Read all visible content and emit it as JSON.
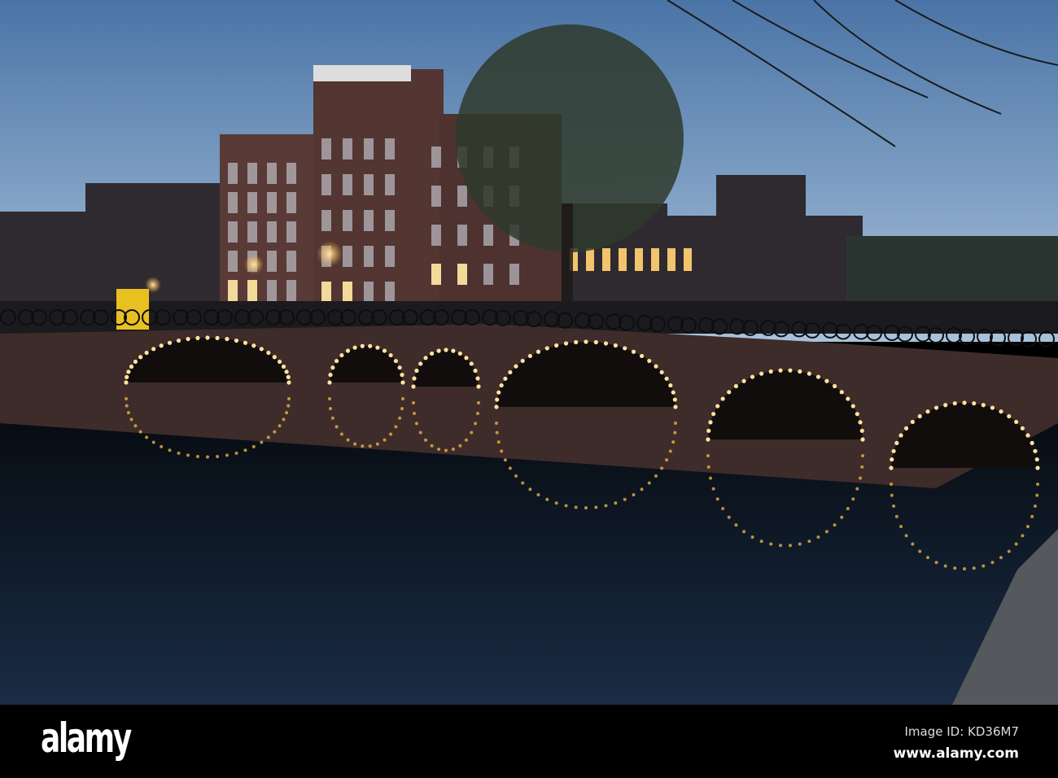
{
  "watermark": {
    "logo": "alamy",
    "image_id": "Image ID: KD36M7",
    "site": "www.alamy.com"
  },
  "colors": {
    "sky_top": "#4f78a8",
    "sky_bottom": "#9cb8d4",
    "brick": "#4a3230",
    "water": "#0b1420",
    "light": "#ffd88a"
  }
}
